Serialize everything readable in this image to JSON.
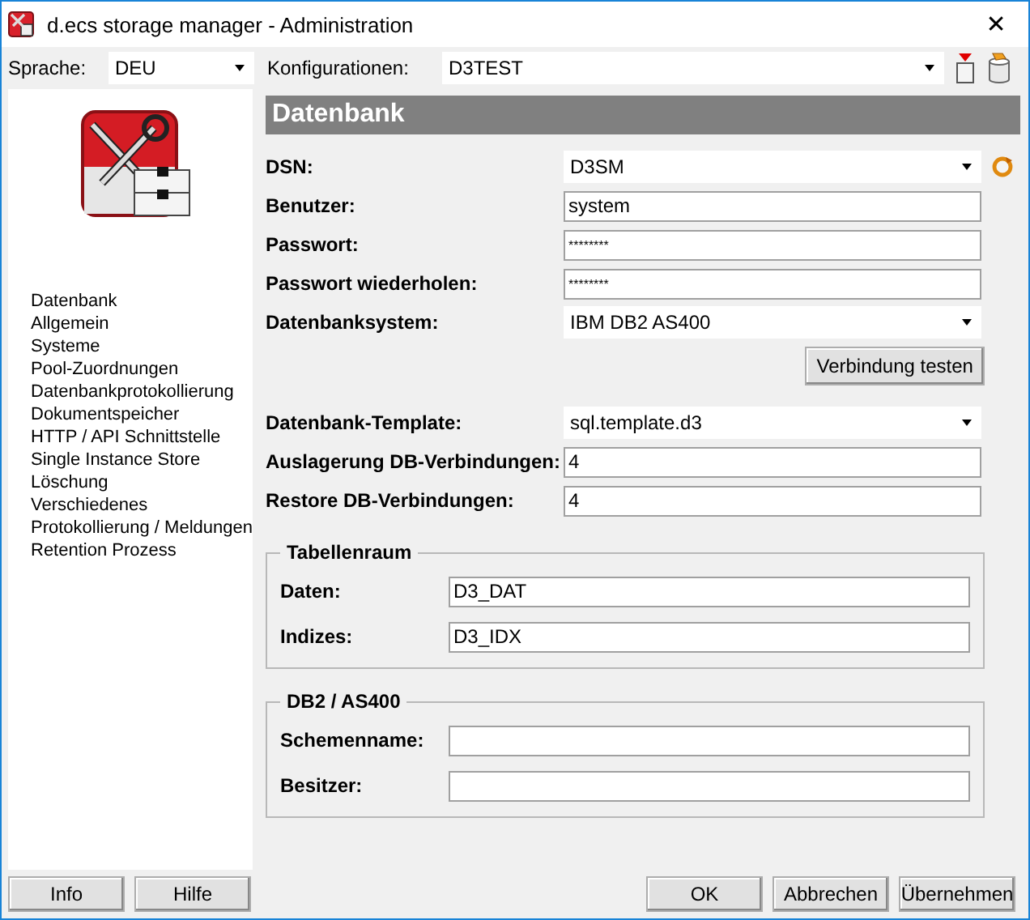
{
  "window": {
    "title": "d.ecs storage manager - Administration",
    "close": "✕"
  },
  "toolbar": {
    "language_label": "Sprache:",
    "language": "DEU",
    "config_label": "Konfigurationen:",
    "config": "D3TEST"
  },
  "sidebar": {
    "items": [
      "Datenbank",
      "Allgemein",
      "Systeme",
      "Pool-Zuordnungen",
      "Datenbankprotokollierung",
      "Dokumentspeicher",
      "HTTP / API Schnittstelle",
      "Single Instance Store",
      "Löschung",
      "Verschiedenes",
      "Protokollierung / Meldungen",
      "Retention Prozess"
    ]
  },
  "section": {
    "title": "Datenbank",
    "rows": [
      {
        "kind": "combo",
        "label": "DSN:",
        "value": "D3SM",
        "refresh": true
      },
      {
        "kind": "text",
        "label": "Benutzer:",
        "value": "system"
      },
      {
        "kind": "password",
        "label": "Passwort:",
        "value": "********"
      },
      {
        "kind": "password",
        "label": "Passwort wiederholen:",
        "value": "********"
      },
      {
        "kind": "combo",
        "label": "Datenbanksystem:",
        "value": "IBM DB2 AS400"
      },
      {
        "kind": "button",
        "label": "Verbindung testen"
      },
      {
        "kind": "combo",
        "label": "Datenbank-Template:",
        "value": "sql.template.d3"
      },
      {
        "kind": "text",
        "label": "Auslagerung DB-Verbindungen:",
        "value": "4"
      },
      {
        "kind": "text",
        "label": "Restore DB-Verbindungen:",
        "value": "4"
      }
    ],
    "groups": [
      {
        "title": "Tabellenraum",
        "fields": [
          {
            "label": "Daten:",
            "value": "D3_DAT"
          },
          {
            "label": "Indizes:",
            "value": "D3_IDX"
          }
        ]
      },
      {
        "title": "DB2 / AS400",
        "fields": [
          {
            "label": "Schemenname:"
          },
          {
            "label": "Besitzer:"
          }
        ]
      }
    ]
  },
  "footer": {
    "left_buttons": [
      "Info",
      "Hilfe"
    ],
    "right_buttons": [
      "OK",
      "Abbrechen",
      "Übernehmen"
    ]
  }
}
